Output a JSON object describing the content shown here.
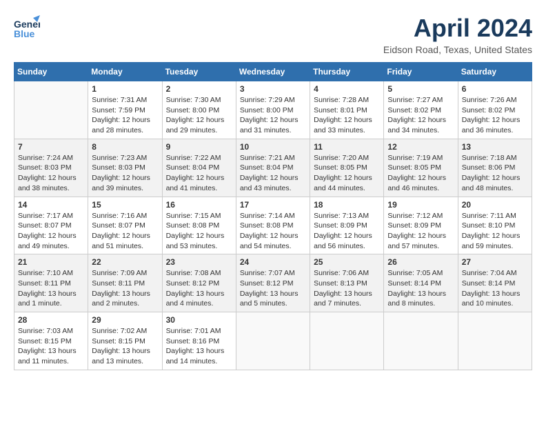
{
  "header": {
    "logo_general": "General",
    "logo_blue": "Blue",
    "month_title": "April 2024",
    "location": "Eidson Road, Texas, United States"
  },
  "days_of_week": [
    "Sunday",
    "Monday",
    "Tuesday",
    "Wednesday",
    "Thursday",
    "Friday",
    "Saturday"
  ],
  "weeks": [
    [
      {
        "day": "",
        "empty": true
      },
      {
        "day": "1",
        "sunrise": "Sunrise: 7:31 AM",
        "sunset": "Sunset: 7:59 PM",
        "daylight": "Daylight: 12 hours and 28 minutes."
      },
      {
        "day": "2",
        "sunrise": "Sunrise: 7:30 AM",
        "sunset": "Sunset: 8:00 PM",
        "daylight": "Daylight: 12 hours and 29 minutes."
      },
      {
        "day": "3",
        "sunrise": "Sunrise: 7:29 AM",
        "sunset": "Sunset: 8:00 PM",
        "daylight": "Daylight: 12 hours and 31 minutes."
      },
      {
        "day": "4",
        "sunrise": "Sunrise: 7:28 AM",
        "sunset": "Sunset: 8:01 PM",
        "daylight": "Daylight: 12 hours and 33 minutes."
      },
      {
        "day": "5",
        "sunrise": "Sunrise: 7:27 AM",
        "sunset": "Sunset: 8:02 PM",
        "daylight": "Daylight: 12 hours and 34 minutes."
      },
      {
        "day": "6",
        "sunrise": "Sunrise: 7:26 AM",
        "sunset": "Sunset: 8:02 PM",
        "daylight": "Daylight: 12 hours and 36 minutes."
      }
    ],
    [
      {
        "day": "7",
        "sunrise": "Sunrise: 7:24 AM",
        "sunset": "Sunset: 8:03 PM",
        "daylight": "Daylight: 12 hours and 38 minutes."
      },
      {
        "day": "8",
        "sunrise": "Sunrise: 7:23 AM",
        "sunset": "Sunset: 8:03 PM",
        "daylight": "Daylight: 12 hours and 39 minutes."
      },
      {
        "day": "9",
        "sunrise": "Sunrise: 7:22 AM",
        "sunset": "Sunset: 8:04 PM",
        "daylight": "Daylight: 12 hours and 41 minutes."
      },
      {
        "day": "10",
        "sunrise": "Sunrise: 7:21 AM",
        "sunset": "Sunset: 8:04 PM",
        "daylight": "Daylight: 12 hours and 43 minutes."
      },
      {
        "day": "11",
        "sunrise": "Sunrise: 7:20 AM",
        "sunset": "Sunset: 8:05 PM",
        "daylight": "Daylight: 12 hours and 44 minutes."
      },
      {
        "day": "12",
        "sunrise": "Sunrise: 7:19 AM",
        "sunset": "Sunset: 8:05 PM",
        "daylight": "Daylight: 12 hours and 46 minutes."
      },
      {
        "day": "13",
        "sunrise": "Sunrise: 7:18 AM",
        "sunset": "Sunset: 8:06 PM",
        "daylight": "Daylight: 12 hours and 48 minutes."
      }
    ],
    [
      {
        "day": "14",
        "sunrise": "Sunrise: 7:17 AM",
        "sunset": "Sunset: 8:07 PM",
        "daylight": "Daylight: 12 hours and 49 minutes."
      },
      {
        "day": "15",
        "sunrise": "Sunrise: 7:16 AM",
        "sunset": "Sunset: 8:07 PM",
        "daylight": "Daylight: 12 hours and 51 minutes."
      },
      {
        "day": "16",
        "sunrise": "Sunrise: 7:15 AM",
        "sunset": "Sunset: 8:08 PM",
        "daylight": "Daylight: 12 hours and 53 minutes."
      },
      {
        "day": "17",
        "sunrise": "Sunrise: 7:14 AM",
        "sunset": "Sunset: 8:08 PM",
        "daylight": "Daylight: 12 hours and 54 minutes."
      },
      {
        "day": "18",
        "sunrise": "Sunrise: 7:13 AM",
        "sunset": "Sunset: 8:09 PM",
        "daylight": "Daylight: 12 hours and 56 minutes."
      },
      {
        "day": "19",
        "sunrise": "Sunrise: 7:12 AM",
        "sunset": "Sunset: 8:09 PM",
        "daylight": "Daylight: 12 hours and 57 minutes."
      },
      {
        "day": "20",
        "sunrise": "Sunrise: 7:11 AM",
        "sunset": "Sunset: 8:10 PM",
        "daylight": "Daylight: 12 hours and 59 minutes."
      }
    ],
    [
      {
        "day": "21",
        "sunrise": "Sunrise: 7:10 AM",
        "sunset": "Sunset: 8:11 PM",
        "daylight": "Daylight: 13 hours and 1 minute."
      },
      {
        "day": "22",
        "sunrise": "Sunrise: 7:09 AM",
        "sunset": "Sunset: 8:11 PM",
        "daylight": "Daylight: 13 hours and 2 minutes."
      },
      {
        "day": "23",
        "sunrise": "Sunrise: 7:08 AM",
        "sunset": "Sunset: 8:12 PM",
        "daylight": "Daylight: 13 hours and 4 minutes."
      },
      {
        "day": "24",
        "sunrise": "Sunrise: 7:07 AM",
        "sunset": "Sunset: 8:12 PM",
        "daylight": "Daylight: 13 hours and 5 minutes."
      },
      {
        "day": "25",
        "sunrise": "Sunrise: 7:06 AM",
        "sunset": "Sunset: 8:13 PM",
        "daylight": "Daylight: 13 hours and 7 minutes."
      },
      {
        "day": "26",
        "sunrise": "Sunrise: 7:05 AM",
        "sunset": "Sunset: 8:14 PM",
        "daylight": "Daylight: 13 hours and 8 minutes."
      },
      {
        "day": "27",
        "sunrise": "Sunrise: 7:04 AM",
        "sunset": "Sunset: 8:14 PM",
        "daylight": "Daylight: 13 hours and 10 minutes."
      }
    ],
    [
      {
        "day": "28",
        "sunrise": "Sunrise: 7:03 AM",
        "sunset": "Sunset: 8:15 PM",
        "daylight": "Daylight: 13 hours and 11 minutes."
      },
      {
        "day": "29",
        "sunrise": "Sunrise: 7:02 AM",
        "sunset": "Sunset: 8:15 PM",
        "daylight": "Daylight: 13 hours and 13 minutes."
      },
      {
        "day": "30",
        "sunrise": "Sunrise: 7:01 AM",
        "sunset": "Sunset: 8:16 PM",
        "daylight": "Daylight: 13 hours and 14 minutes."
      },
      {
        "day": "",
        "empty": true
      },
      {
        "day": "",
        "empty": true
      },
      {
        "day": "",
        "empty": true
      },
      {
        "day": "",
        "empty": true
      }
    ]
  ]
}
